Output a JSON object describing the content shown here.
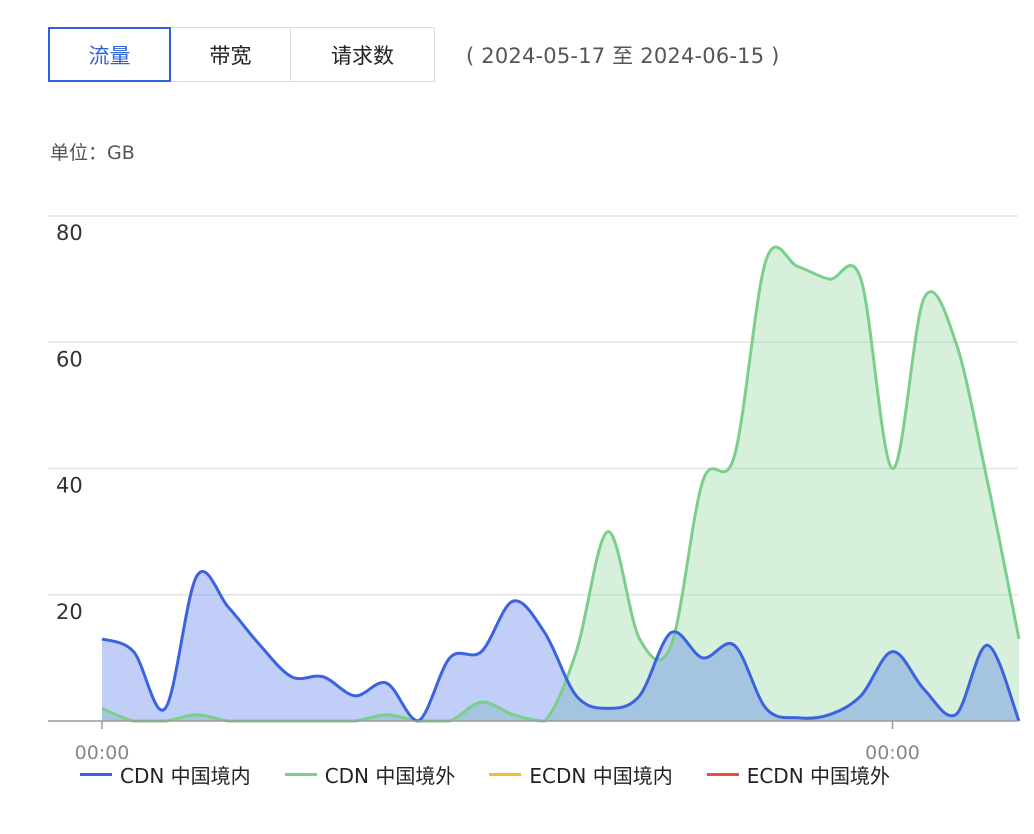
{
  "tabs": [
    {
      "label": "流量",
      "active": true
    },
    {
      "label": "带宽",
      "active": false
    },
    {
      "label": "请求数",
      "active": false
    }
  ],
  "date_range": "( 2024-05-17 至 2024-06-15 )",
  "unit_label": "单位：GB",
  "colors": {
    "cdn_domestic": "#3b63e0",
    "cdn_overseas": "#7bcf8a",
    "ecdn_domestic": "#f0c02c",
    "ecdn_overseas": "#e2523f",
    "grid": "#e6e6e6",
    "axis": "#9a9a9a"
  },
  "chart_data": {
    "type": "area",
    "title": "",
    "xlabel": "",
    "ylabel": "",
    "ylim": [
      0,
      80
    ],
    "yticks": [
      20,
      40,
      60,
      80
    ],
    "xtick_labels": [
      "00:00",
      "00:00"
    ],
    "grid": true,
    "legend_position": "bottom",
    "series": [
      {
        "name": "CDN 中国境内",
        "values": [
          13,
          11,
          2,
          23,
          18,
          12,
          7,
          7,
          4,
          6,
          0,
          10,
          11,
          19,
          14,
          4,
          2,
          4,
          14,
          10,
          12,
          2,
          0.5,
          1,
          4,
          11,
          5,
          1,
          12,
          0
        ]
      },
      {
        "name": "CDN 中国境外",
        "values": [
          2,
          0,
          0,
          1,
          0,
          0,
          0,
          0,
          0,
          1,
          0,
          0,
          3,
          1,
          0,
          11,
          30,
          13,
          12,
          38,
          42,
          73,
          72,
          70,
          70,
          40,
          67,
          60,
          38,
          13
        ]
      },
      {
        "name": "ECDN 中国境内",
        "values": [
          0,
          0,
          0,
          0,
          0,
          0,
          0,
          0,
          0,
          0,
          0,
          0,
          0,
          0,
          0,
          0,
          0,
          0,
          0,
          0,
          0,
          0,
          0,
          0,
          0,
          0,
          0,
          0,
          0,
          0
        ]
      },
      {
        "name": "ECDN 中国境外",
        "values": [
          0,
          0,
          0,
          0,
          0,
          0,
          0,
          0,
          0,
          0,
          0,
          0,
          0,
          0,
          0,
          0,
          0,
          0,
          0,
          0,
          0,
          0,
          0,
          0,
          0,
          0,
          0,
          0,
          0,
          0
        ]
      }
    ]
  }
}
